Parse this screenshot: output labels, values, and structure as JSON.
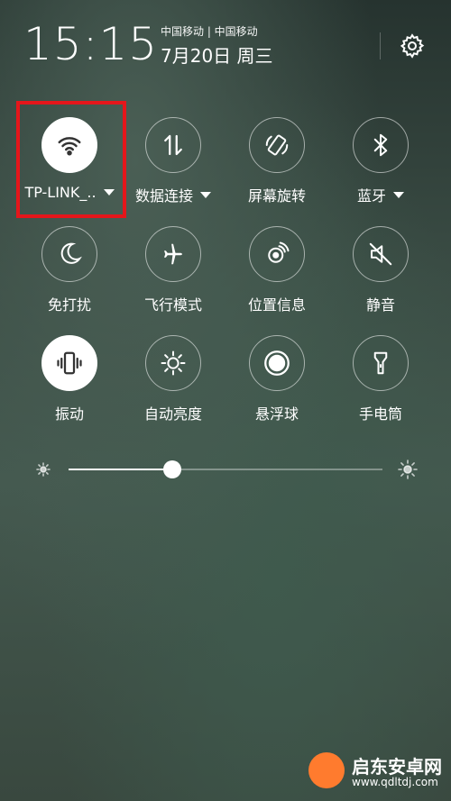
{
  "status": {
    "time": "15:15",
    "carrier": "中国移动 | 中国移动",
    "date": "7月20日 周三"
  },
  "tiles": [
    {
      "label": "TP-LINK_..",
      "icon": "wifi-icon",
      "active": true,
      "caret": true
    },
    {
      "label": "数据连接",
      "icon": "mobile-data-icon",
      "active": false,
      "caret": true
    },
    {
      "label": "屏幕旋转",
      "icon": "rotate-screen-icon",
      "active": false,
      "caret": false
    },
    {
      "label": "蓝牙",
      "icon": "bluetooth-icon",
      "active": false,
      "caret": true
    },
    {
      "label": "免打扰",
      "icon": "moon-icon",
      "active": false,
      "caret": false
    },
    {
      "label": "飞行模式",
      "icon": "airplane-icon",
      "active": false,
      "caret": false
    },
    {
      "label": "位置信息",
      "icon": "location-icon",
      "active": false,
      "caret": false
    },
    {
      "label": "静音",
      "icon": "mute-icon",
      "active": false,
      "caret": false
    },
    {
      "label": "振动",
      "icon": "vibrate-icon",
      "active": true,
      "caret": false
    },
    {
      "label": "自动亮度",
      "icon": "auto-brightness-icon",
      "active": false,
      "caret": false
    },
    {
      "label": "悬浮球",
      "icon": "floating-ball-icon",
      "active": false,
      "caret": false
    },
    {
      "label": "手电筒",
      "icon": "flashlight-icon",
      "active": false,
      "caret": false
    }
  ],
  "brightness": {
    "level": 0.33
  },
  "watermark": {
    "title": "启东安卓网",
    "url": "www.qdltdj.com"
  },
  "colors": {
    "highlight": "#e5161b",
    "active_icon": "#333333"
  }
}
